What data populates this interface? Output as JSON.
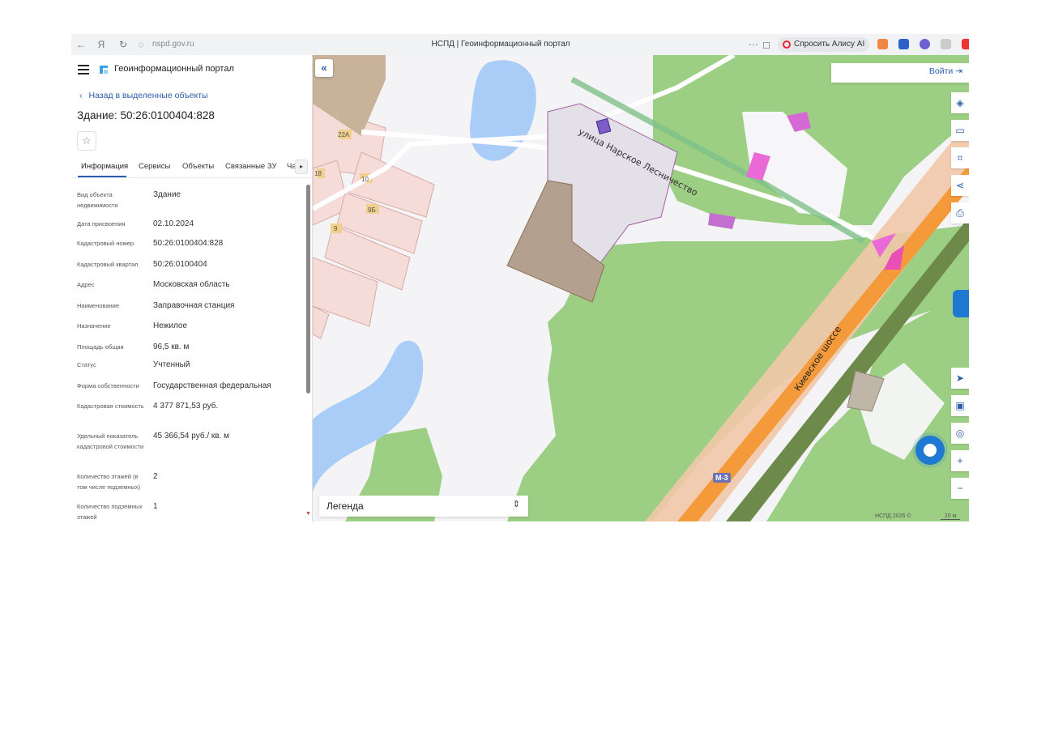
{
  "browser": {
    "address": "nspd.gov.ru",
    "tab_title": "НСПД | Геоинформационный портал",
    "alisa_label": "Спросить Алису AI",
    "icons": [
      "back-icon",
      "yandex-icon",
      "reload-icon",
      "shield-icon",
      "more-icon",
      "bookmark-icon",
      "alisa-icon"
    ]
  },
  "header": {
    "portal_title": "Геоинформационный портал"
  },
  "panel": {
    "back_label": "Назад в выделенные объекты",
    "object_title": "Здание: 50:26:0100404:828",
    "tabs": [
      {
        "label": "Информация"
      },
      {
        "label": "Сервисы"
      },
      {
        "label": "Объекты"
      },
      {
        "label": "Связанные ЗУ"
      },
      {
        "label": "Ча"
      }
    ],
    "properties": [
      {
        "label": "Вид объекта недвижимости",
        "value": "Здание"
      },
      {
        "label": "Дата присвоения",
        "value": "02.10.2024"
      },
      {
        "label": "Кадастровый номер",
        "value": "50:26:0100404:828"
      },
      {
        "label": "Кадастровый квартал",
        "value": "50:26:0100404"
      },
      {
        "label": "Адрес",
        "value": "Московская область"
      },
      {
        "label": "Наименование",
        "value": "Заправочная станция"
      },
      {
        "label": "Назначение",
        "value": "Нежилое"
      },
      {
        "label": "Площадь общая",
        "value": "96,5 кв. м"
      },
      {
        "label": "Статус",
        "value": "Учтенный"
      },
      {
        "label": "Форма собственности",
        "value": "Государственная федеральная"
      },
      {
        "label": "Кадастровая стоимость",
        "value": "4 377 871,53 руб."
      },
      {
        "label": "Удельный показатель кадастровой стоимости",
        "value": "45 366,54 руб./ кв. м"
      },
      {
        "label": "Количество этажей (в том числе подземных)",
        "value": "2"
      },
      {
        "label": "Количество подземных этажей",
        "value": "1"
      }
    ]
  },
  "map": {
    "login_label": "Войти",
    "legend_label": "Легенда",
    "street_label": "улица Нарское Лесничество",
    "highway_label": "Киевское шоссе",
    "route_label": "М-3",
    "lot_numbers": [
      "22А",
      "18",
      "10",
      "9Б",
      "9"
    ],
    "copyright": "НСПД 2026 ©",
    "scale": "20 м",
    "tools": [
      "layers-icon",
      "ruler-icon",
      "select-area-icon",
      "share-icon",
      "print-icon",
      "locate-icon",
      "basemap-icon",
      "geo-search-icon",
      "zoom-in-icon",
      "zoom-out-icon"
    ],
    "colors": {
      "forest": "#9ccf84",
      "water": "#a9cdf7",
      "road": "#f2c8a8",
      "highway": "#f49a3a",
      "parcel": "#f6dcd8",
      "building": "#b4a08e",
      "accent": "#2a5dab"
    }
  }
}
